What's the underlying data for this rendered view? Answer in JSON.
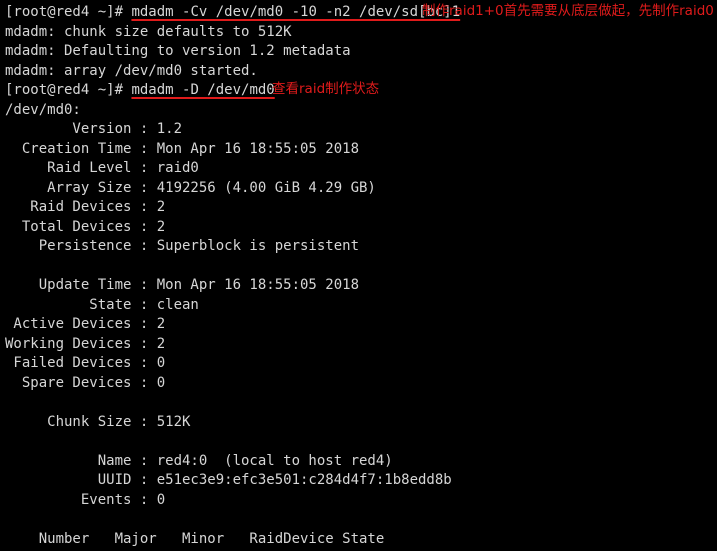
{
  "terminal": {
    "background_color": "#000000",
    "text_color": "#d6d6d6",
    "annotation_color": "#e01b1b",
    "prompt": "[root@red4 ~]# ",
    "lines": [
      {
        "type": "prompt-cmd",
        "prompt": "[root@red4 ~]# ",
        "command": "mdadm -Cv /dev/md0 -10 -n2 /dev/sd[bc]1"
      },
      {
        "type": "output",
        "text": "mdadm: chunk size defaults to 512K"
      },
      {
        "type": "output",
        "text": "mdadm: Defaulting to version 1.2 metadata"
      },
      {
        "type": "output",
        "text": "mdadm: array /dev/md0 started."
      },
      {
        "type": "prompt-cmd",
        "prompt": "[root@red4 ~]# ",
        "command": "mdadm -D /dev/md0"
      },
      {
        "type": "output",
        "text": "/dev/md0:"
      },
      {
        "type": "output",
        "text": "        Version : 1.2"
      },
      {
        "type": "output",
        "text": "  Creation Time : Mon Apr 16 18:55:05 2018"
      },
      {
        "type": "output",
        "text": "     Raid Level : raid0"
      },
      {
        "type": "output",
        "text": "     Array Size : 4192256 (4.00 GiB 4.29 GB)"
      },
      {
        "type": "output",
        "text": "   Raid Devices : 2"
      },
      {
        "type": "output",
        "text": "  Total Devices : 2"
      },
      {
        "type": "output",
        "text": "    Persistence : Superblock is persistent"
      },
      {
        "type": "blank",
        "text": ""
      },
      {
        "type": "output",
        "text": "    Update Time : Mon Apr 16 18:55:05 2018"
      },
      {
        "type": "output",
        "text": "          State : clean"
      },
      {
        "type": "output",
        "text": " Active Devices : 2"
      },
      {
        "type": "output",
        "text": "Working Devices : 2"
      },
      {
        "type": "output",
        "text": " Failed Devices : 0"
      },
      {
        "type": "output",
        "text": "  Spare Devices : 0"
      },
      {
        "type": "blank",
        "text": ""
      },
      {
        "type": "output",
        "text": "     Chunk Size : 512K"
      },
      {
        "type": "blank",
        "text": ""
      },
      {
        "type": "output",
        "text": "           Name : red4:0  (local to host red4)"
      },
      {
        "type": "output",
        "text": "           UUID : e51ec3e9:efc3e501:c284d4f7:1b8edd8b"
      },
      {
        "type": "output",
        "text": "         Events : 0"
      },
      {
        "type": "blank",
        "text": ""
      },
      {
        "type": "output",
        "text": "    Number   Major   Minor   RaidDevice State"
      }
    ],
    "annotations": [
      {
        "id": "annot-1",
        "text": "制作raid1+0首先需要从底层做起，先制作raid0"
      },
      {
        "id": "annot-2",
        "text": "查看raid制作状态"
      }
    ]
  },
  "details": {
    "device": "/dev/md0",
    "version": "1.2",
    "creation_time": "Mon Apr 16 18:55:05 2018",
    "raid_level": "raid0",
    "array_size": "4192256 (4.00 GiB 4.29 GB)",
    "raid_devices": "2",
    "total_devices": "2",
    "persistence": "Superblock is persistent",
    "update_time": "Mon Apr 16 18:55:05 2018",
    "state": "clean",
    "active_devices": "2",
    "working_devices": "2",
    "failed_devices": "0",
    "spare_devices": "0",
    "chunk_size": "512K",
    "name": "red4:0  (local to host red4)",
    "uuid": "e51ec3e9:efc3e501:c284d4f7:1b8edd8b",
    "events": "0",
    "table_header": "Number   Major   Minor   RaidDevice State"
  }
}
